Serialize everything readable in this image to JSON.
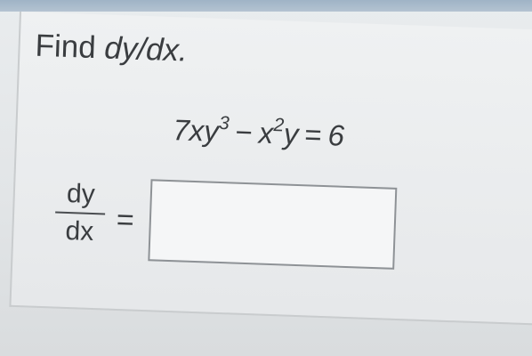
{
  "question": {
    "prompt_word": "Find",
    "prompt_target": "dy/dx.",
    "equation": {
      "t1_coef": "7xy",
      "t1_exp": "3",
      "minus": "−",
      "t2_base": "x",
      "t2_exp": "2",
      "t2_tail": "y",
      "equals": "=",
      "rhs": "6"
    },
    "answer": {
      "numerator": "dy",
      "denominator": "dx",
      "equals": "=",
      "value": ""
    }
  }
}
